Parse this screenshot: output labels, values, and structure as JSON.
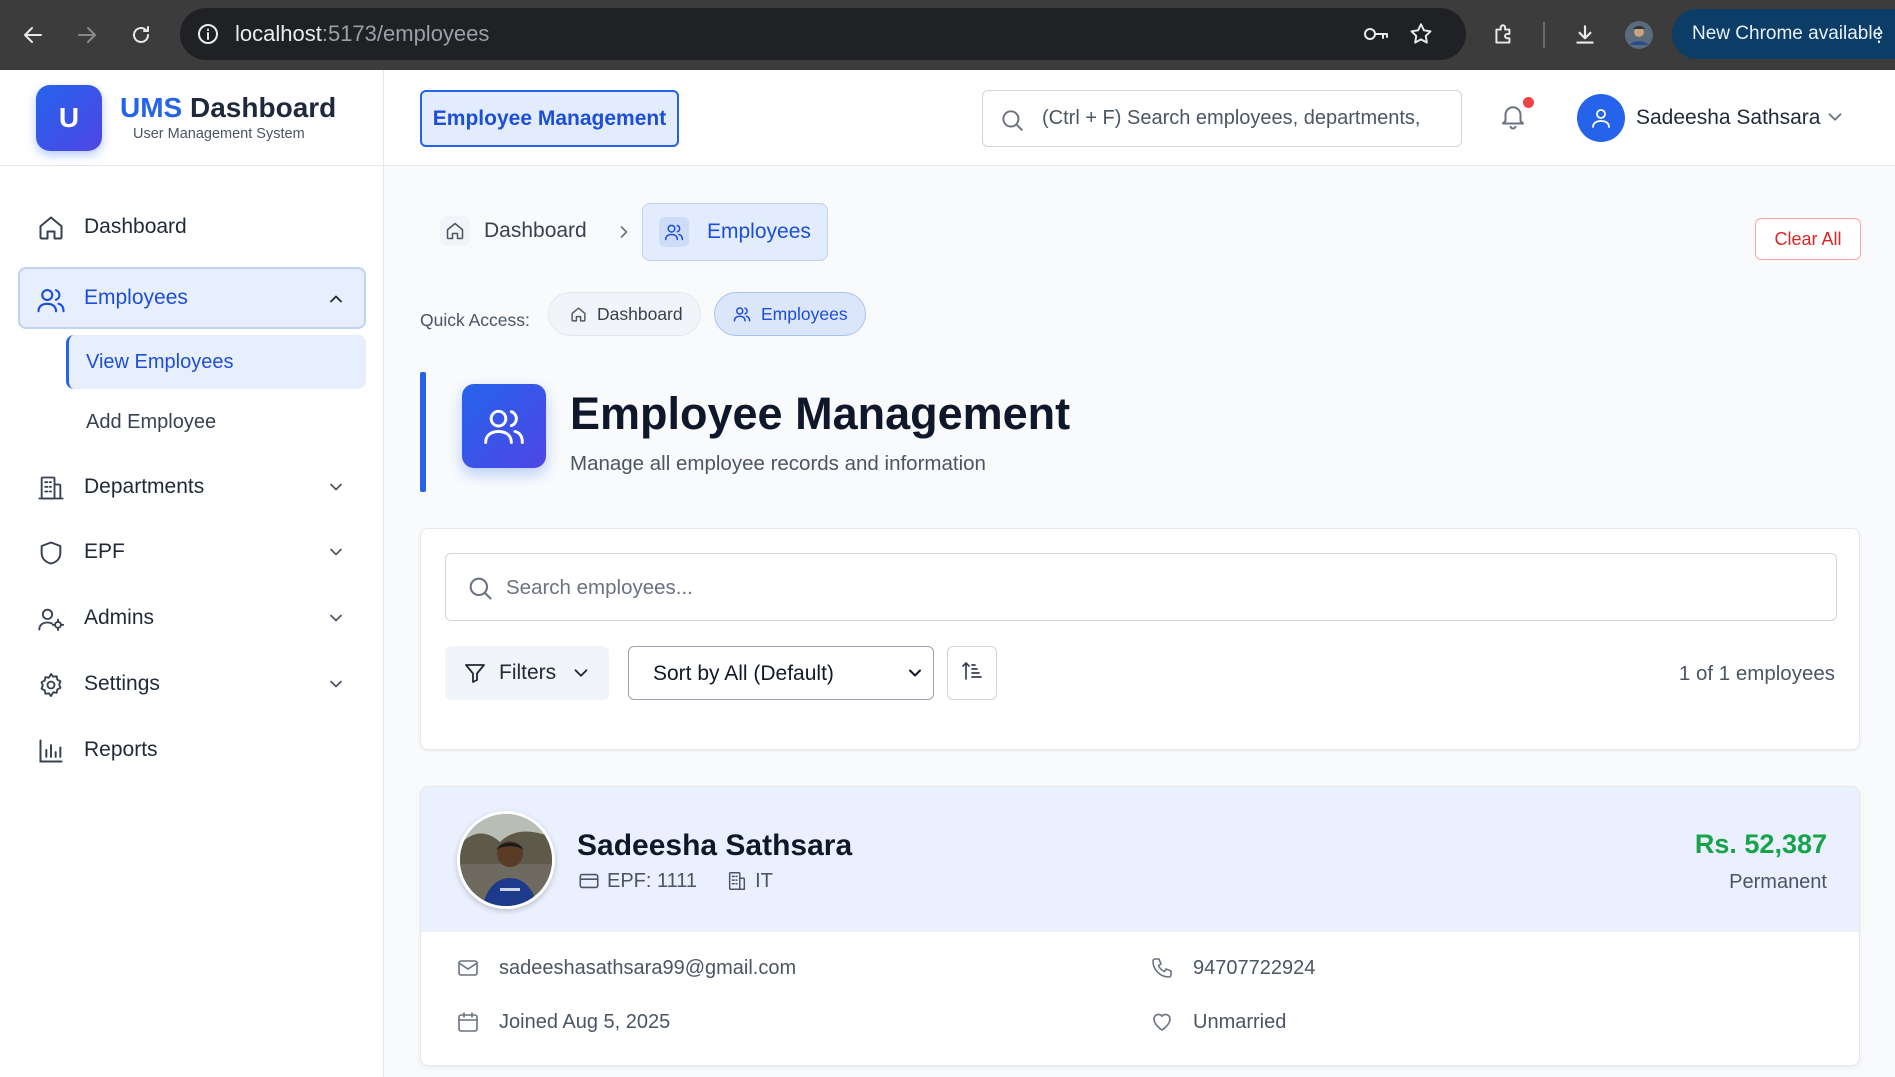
{
  "browser": {
    "url_host": "localhost",
    "url_path": ":5173/employees",
    "update_label": "New Chrome available"
  },
  "brand": {
    "logo_letter": "U",
    "title_accent": "UMS",
    "title_rest": " Dashboard",
    "subtitle": "User Management System"
  },
  "sidebar": {
    "items": [
      {
        "label": "Dashboard",
        "icon": "home-icon"
      },
      {
        "label": "Employees",
        "icon": "users-icon",
        "expanded": true
      },
      {
        "label": "Departments",
        "icon": "building-icon"
      },
      {
        "label": "EPF",
        "icon": "shield-icon"
      },
      {
        "label": "Admins",
        "icon": "user-cog-icon"
      },
      {
        "label": "Settings",
        "icon": "gear-icon"
      },
      {
        "label": "Reports",
        "icon": "bar-chart-icon"
      }
    ],
    "sub_items": [
      {
        "label": "View Employees",
        "active": true
      },
      {
        "label": "Add Employee"
      }
    ]
  },
  "header": {
    "page_chip": "Employee Management",
    "search_placeholder": "(Ctrl + F) Search employees, departments,",
    "user_name": "Sadeesha Sathsara"
  },
  "breadcrumb": {
    "home": "Dashboard",
    "current": "Employees",
    "clear_all": "Clear All"
  },
  "quick_access": {
    "label": "Quick Access:",
    "items": [
      "Dashboard",
      "Employees"
    ]
  },
  "page": {
    "title": "Employee Management",
    "subtitle": "Manage all employee records and information"
  },
  "filters": {
    "search_placeholder": "Search employees...",
    "filters_label": "Filters",
    "sort_label": "Sort by All (Default)",
    "count_text": "1 of 1 employees"
  },
  "employee": {
    "name": "Sadeesha Sathsara",
    "epf": "EPF: 1111",
    "department": "IT",
    "salary": "Rs. 52,387",
    "type": "Permanent",
    "email": "sadeeshasathsara99@gmail.com",
    "phone": "94707722924",
    "joined": "Joined Aug 5, 2025",
    "marital": "Unmarried"
  },
  "colors": {
    "accent": "#2563eb",
    "salary": "#16a34a",
    "danger": "#dc2626"
  }
}
